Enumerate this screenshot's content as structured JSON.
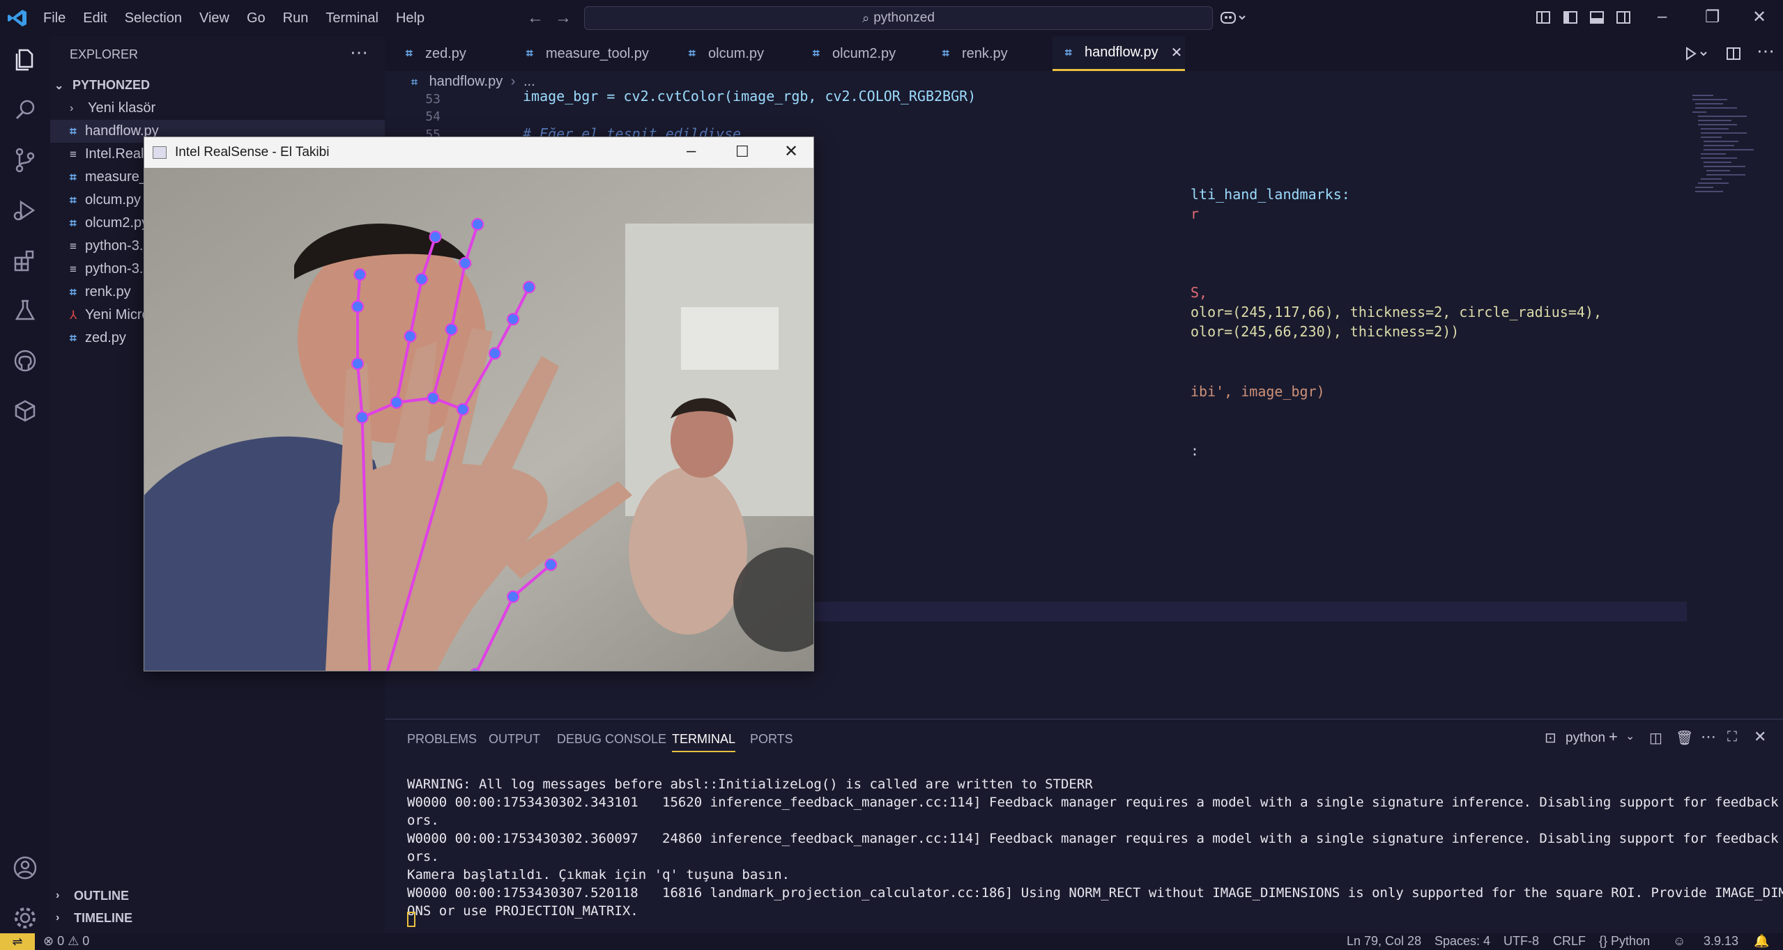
{
  "titlebar": {
    "menus": [
      "File",
      "Edit",
      "Selection",
      "View",
      "Go",
      "Run",
      "Terminal",
      "Help"
    ],
    "search_text": "pythonzed"
  },
  "sidebar": {
    "title": "EXPLORER",
    "folder": "PYTHONZED",
    "items": [
      {
        "label": "Yeni klasör",
        "kind": "folder"
      },
      {
        "label": "handflow.py",
        "kind": "py"
      },
      {
        "label": "Intel.RealS",
        "kind": "txt"
      },
      {
        "label": "measure_",
        "kind": "py"
      },
      {
        "label": "olcum.py",
        "kind": "py"
      },
      {
        "label": "olcum2.py",
        "kind": "py"
      },
      {
        "label": "python-3.",
        "kind": "txt"
      },
      {
        "label": "python-3.",
        "kind": "txt"
      },
      {
        "label": "renk.py",
        "kind": "py"
      },
      {
        "label": "Yeni Micro",
        "kind": "pdf"
      },
      {
        "label": "zed.py",
        "kind": "py"
      }
    ],
    "outline": "OUTLINE",
    "timeline": "TIMELINE"
  },
  "tabs": [
    "zed.py",
    "measure_tool.py",
    "olcum.py",
    "olcum2.py",
    "renk.py",
    "handflow.py"
  ],
  "active_tab": "handflow.py",
  "breadcrumb": {
    "file": "handflow.py",
    "more": "..."
  },
  "editor": {
    "line_numbers": [
      "53",
      "54",
      "55"
    ],
    "line53": "image_bgr = cv2.cvtColor(image_rgb, cv2.COLOR_RGB2BGR)",
    "line55": "# Eğer el tespit edildiyse",
    "frag_landmarks": "lti_hand_landmarks:",
    "frag_r": "r",
    "frag_s": "S,",
    "frag_spec1": "olor=(245,117,66), thickness=2, circle_radius=4),",
    "frag_spec2": "olor=(245,66,230), thickness=2))",
    "frag_imshow": "ibi', image_bgr)",
    "frag_colon": ":"
  },
  "cv_window": {
    "title": "Intel RealSense - El Takibi",
    "landmark_color": "#4f78ff",
    "connection_color": "#e040e6"
  },
  "panel": {
    "tabs": [
      "PROBLEMS",
      "OUTPUT",
      "DEBUG CONSOLE",
      "TERMINAL",
      "PORTS"
    ],
    "active": "TERMINAL",
    "terminal_name": "python",
    "lines": [
      "WARNING: All log messages before absl::InitializeLog() is called are written to STDERR",
      "W0000 00:00:1753430302.343101   15620 inference_feedback_manager.cc:114] Feedback manager requires a model with a single signature inference. Disabling support for feedback tens",
      "ors.",
      "W0000 00:00:1753430302.360097   24860 inference_feedback_manager.cc:114] Feedback manager requires a model with a single signature inference. Disabling support for feedback tens",
      "ors.",
      "Kamera başlatıldı. Çıkmak için 'q' tuşuna basın.",
      "W0000 00:00:1753430307.520118   16816 landmark_projection_calculator.cc:186] Using NORM_RECT without IMAGE_DIMENSIONS is only supported for the square ROI. Provide IMAGE_DIMENSI",
      "ONS or use PROJECTION_MATRIX."
    ]
  },
  "statusbar": {
    "errors": "0",
    "warnings": "0",
    "position": "Ln 79, Col 28",
    "spaces": "Spaces: 4",
    "encoding": "UTF-8",
    "eol": "CRLF",
    "language": "Python",
    "language_brace": "{}",
    "version": "3.9.13"
  },
  "colors": {
    "accent": "#e8c040",
    "background": "#1a1a2e",
    "sidebar": "#171729"
  }
}
